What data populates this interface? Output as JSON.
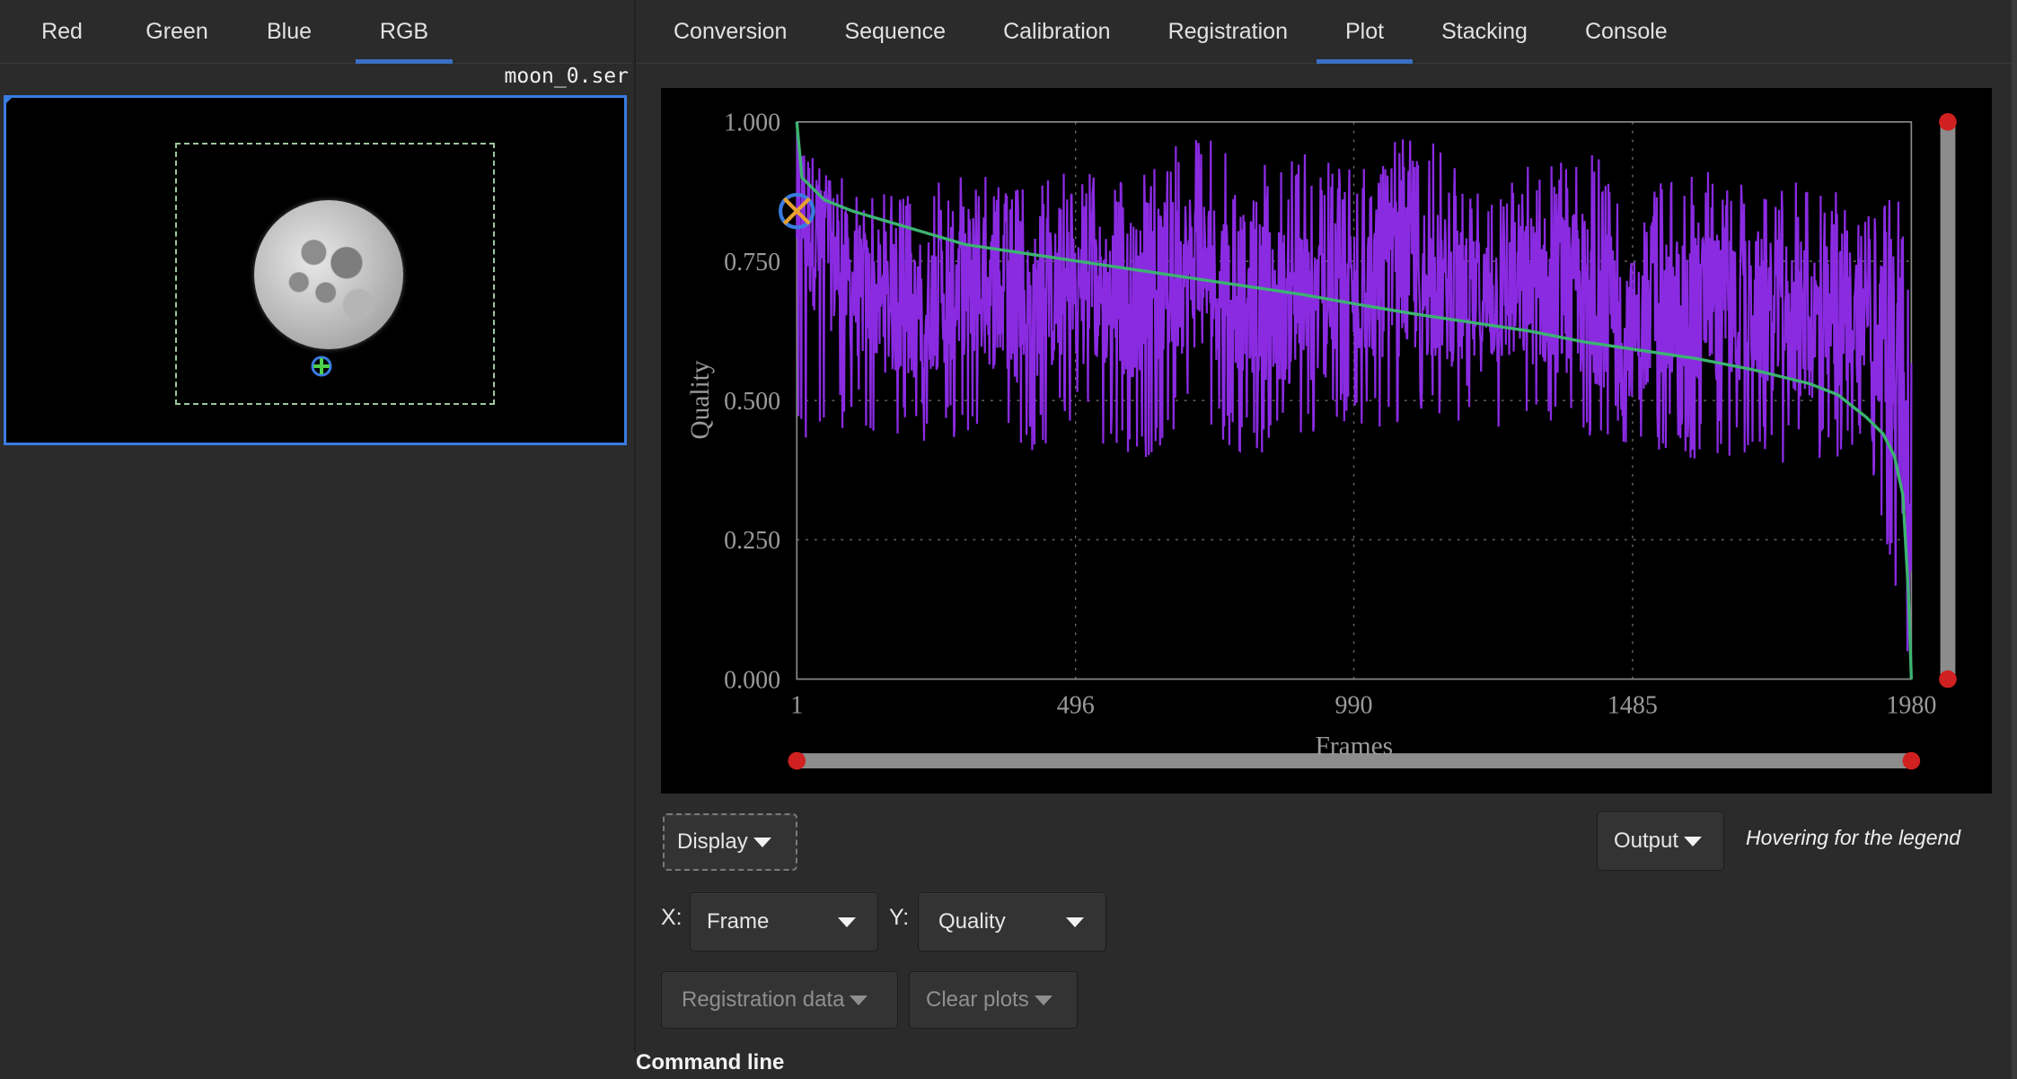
{
  "left_tabs": [
    {
      "label": "Red"
    },
    {
      "label": "Green"
    },
    {
      "label": "Blue"
    },
    {
      "label": "RGB",
      "active": true
    }
  ],
  "preview": {
    "filename": "moon_0.ser"
  },
  "right_tabs": [
    {
      "label": "Conversion"
    },
    {
      "label": "Sequence"
    },
    {
      "label": "Calibration"
    },
    {
      "label": "Registration"
    },
    {
      "label": "Plot",
      "active": true
    },
    {
      "label": "Stacking"
    },
    {
      "label": "Console"
    }
  ],
  "plot": {
    "xlabel": "Frames",
    "ylabel": "Quality",
    "x_ticks": [
      "1",
      "496",
      "990",
      "1485",
      "1980"
    ],
    "y_ticks": [
      "1.000",
      "0.750",
      "0.500",
      "0.250",
      "0.000"
    ]
  },
  "chart_data": {
    "type": "line",
    "xlabel": "Frames",
    "ylabel": "Quality",
    "xlim": [
      1,
      1980
    ],
    "ylim": [
      0.0,
      1.0
    ],
    "x_ticks": [
      1,
      496,
      990,
      1485,
      1980
    ],
    "y_ticks": [
      0.0,
      0.25,
      0.5,
      0.75,
      1.0
    ],
    "grid": true,
    "series": [
      {
        "color": "#8a2be2",
        "style": "noisy",
        "x": [
          1,
          100,
          200,
          300,
          400,
          500,
          600,
          700,
          800,
          900,
          1000,
          1100,
          1200,
          1300,
          1400,
          1500,
          1600,
          1700,
          1800,
          1900,
          1960,
          1975,
          1980
        ],
        "y": [
          0.85,
          0.7,
          0.65,
          0.72,
          0.66,
          0.7,
          0.68,
          0.74,
          0.69,
          0.66,
          0.7,
          0.73,
          0.67,
          0.7,
          0.69,
          0.62,
          0.68,
          0.66,
          0.64,
          0.66,
          0.55,
          0.3,
          0.05
        ],
        "y_min": [
          0.4,
          0.45,
          0.43,
          0.42,
          0.4,
          0.44,
          0.38,
          0.46,
          0.39,
          0.42,
          0.45,
          0.44,
          0.46,
          0.43,
          0.4,
          0.42,
          0.38,
          0.4,
          0.37,
          0.42,
          0.1,
          0.02,
          0.0
        ],
        "y_max": [
          0.95,
          0.9,
          0.87,
          0.93,
          0.88,
          0.92,
          0.89,
          1.0,
          0.91,
          0.95,
          0.92,
          0.99,
          0.9,
          0.93,
          0.96,
          0.87,
          0.93,
          0.88,
          0.9,
          0.86,
          0.86,
          0.7,
          0.6
        ]
      },
      {
        "color": "#3cb371",
        "style": "sorted",
        "x": [
          1,
          10,
          50,
          100,
          200,
          300,
          400,
          500,
          600,
          700,
          800,
          900,
          1000,
          1100,
          1200,
          1300,
          1400,
          1500,
          1600,
          1700,
          1800,
          1850,
          1900,
          1930,
          1950,
          1965,
          1975,
          1980
        ],
        "y": [
          1.0,
          0.9,
          0.86,
          0.84,
          0.81,
          0.78,
          0.765,
          0.75,
          0.735,
          0.72,
          0.705,
          0.69,
          0.672,
          0.655,
          0.64,
          0.625,
          0.605,
          0.59,
          0.575,
          0.555,
          0.53,
          0.51,
          0.47,
          0.44,
          0.4,
          0.33,
          0.15,
          0.0
        ]
      }
    ],
    "selected_point": {
      "x": 1,
      "y": 0.84
    }
  },
  "buttons": {
    "display": "Display",
    "output": "Output",
    "x_prefix": "X:",
    "x_value": "Frame",
    "y_prefix": "Y:",
    "y_value": "Quality",
    "registration_data": "Registration data",
    "clear_plots": "Clear plots"
  },
  "hover_legend": "Hovering for the legend",
  "command_line": "Command line"
}
